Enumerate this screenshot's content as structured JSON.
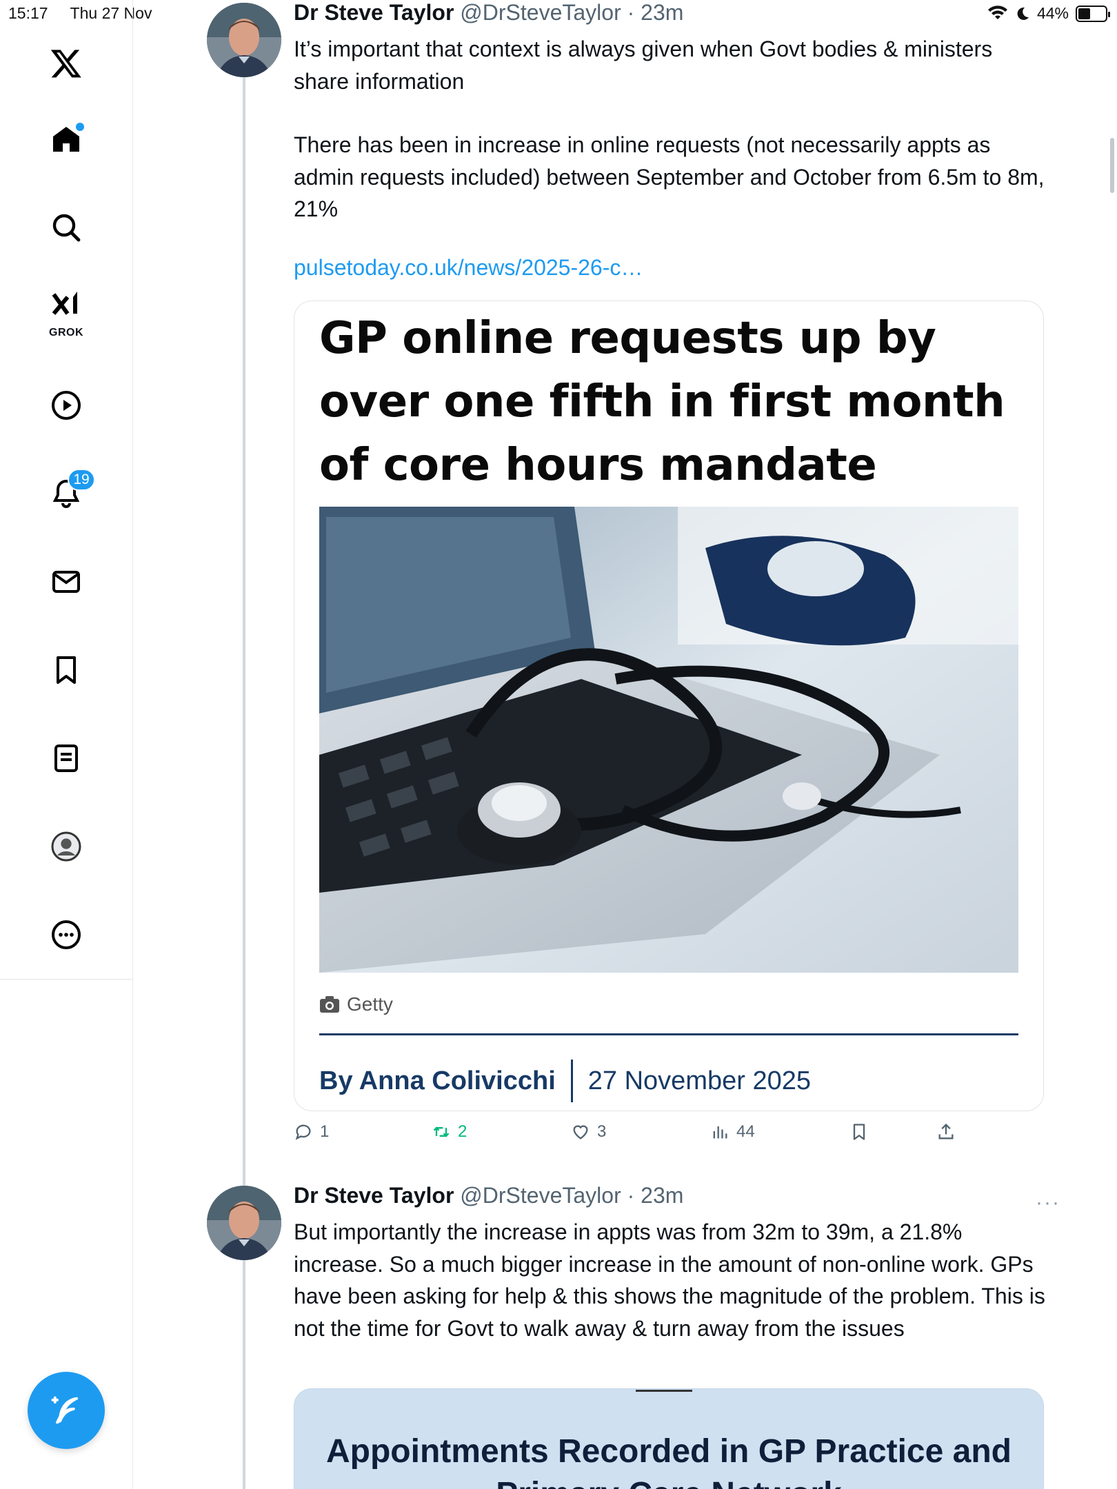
{
  "status_bar": {
    "time": "15:17",
    "date": "Thu 27 Nov",
    "battery": "44%",
    "battery_level": 0.44
  },
  "sidebar": {
    "logo": "x-logo-icon",
    "items": [
      {
        "name": "home",
        "icon": "home-icon",
        "has_dot": true
      },
      {
        "name": "search",
        "icon": "search-icon"
      },
      {
        "name": "grok",
        "icon": "grok-icon",
        "label": "GROK"
      },
      {
        "name": "video",
        "icon": "play-icon"
      },
      {
        "name": "notifications",
        "icon": "bell-icon",
        "badge": "19"
      },
      {
        "name": "messages",
        "icon": "mail-icon"
      },
      {
        "name": "bookmarks",
        "icon": "bookmark-icon"
      },
      {
        "name": "lists",
        "icon": "list-icon"
      },
      {
        "name": "profile",
        "icon": "profile-icon"
      },
      {
        "name": "more",
        "icon": "more-icon"
      }
    ],
    "compose_icon": "compose-icon"
  },
  "tweets": [
    {
      "name": "Dr Steve Taylor",
      "handle": "@DrSteveTaylor",
      "separator": "·",
      "time": "23m",
      "paragraphs": [
        "It’s important that context is always given when Govt bodies & ministers share information",
        "There has been in increase in online requests (not necessarily appts as admin requests included) between September and October from 6.5m to 8m, 21%"
      ],
      "link": "pulsetoday.co.uk/news/2025-26-c…",
      "card": {
        "headline": "GP online requests up by over one fifth in first month of core hours mandate",
        "credit": "Getty",
        "author": "By Anna Colivicchi",
        "date": "27 November 2025"
      },
      "actions": {
        "replies": "1",
        "retweets": "2",
        "likes": "3",
        "views": "44"
      }
    },
    {
      "name": "Dr Steve Taylor",
      "handle": "@DrSteveTaylor",
      "separator": "·",
      "time": "23m",
      "more": "···",
      "text": "But importantly the increase in appts was from 32m to 39m, a 21.8% increase. So a much bigger increase in the amount of non-online work. GPs have been asking for help & this shows the magnitude of the problem. This is not the time for Govt to walk away & turn away from the issues",
      "card": {
        "title": "Appointments Recorded in GP Practice and Primary Care Network"
      }
    }
  ],
  "colors": {
    "accent": "#1d9bf0",
    "retweet": "#00ba7c",
    "muted": "#536471",
    "byline": "#173a66"
  }
}
